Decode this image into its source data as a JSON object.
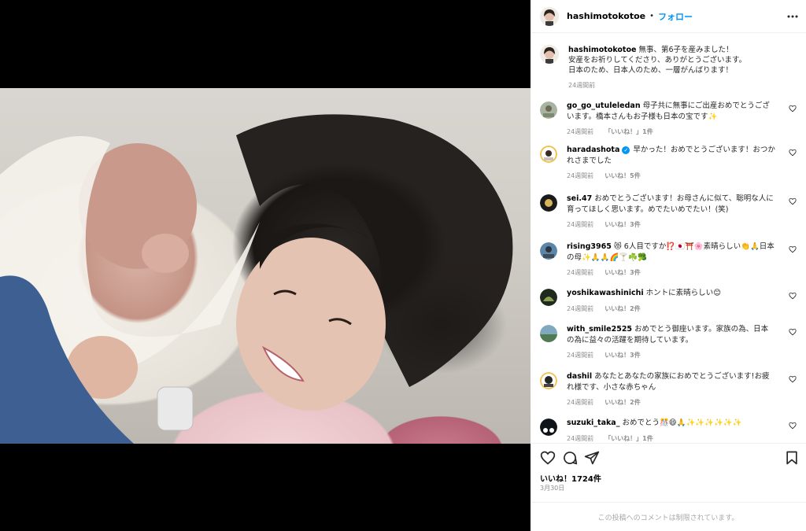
{
  "header": {
    "username": "hashimotokotoe",
    "separator": "•",
    "follow_label": "フォロー"
  },
  "caption": {
    "username": "hashimotokotoe",
    "text": "無事、第6子を産みました！\n安産をお祈りしてくださり、ありがとうございます。\n日本のため、日本人のため、一層がんばります！",
    "time": "24週間前"
  },
  "comments": [
    {
      "username": "go_go_utuleledan",
      "text": "母子共に無事にご出産おめでとうございます。橋本さんもお子様も日本の宝です✨",
      "time": "24週間前",
      "likes": "「いいね！」1件",
      "reply": ""
    },
    {
      "username": "haradashota",
      "verified": true,
      "text": "早かった！おめでとうございます！おつかれさまでした",
      "time": "24週間前",
      "likes": "いいね！5件",
      "reply": ""
    },
    {
      "username": "sei.47",
      "text": "おめでとうございます！お母さんに似て、聡明な人に育ってほしく思います。めでたいめでたい！(笑)",
      "time": "24週間前",
      "likes": "いいね！3件",
      "reply": ""
    },
    {
      "username": "rising3965",
      "text": "😻 6人目ですか⁉️🇯🇵⛩️🌸素晴らしい👏🙏日本の母✨🙏🙏🌈🍸☘️🥦",
      "time": "24週間前",
      "likes": "いいね！3件",
      "reply": ""
    },
    {
      "username": "yoshikawashinichi",
      "text": "ホントに素晴らしい😊",
      "time": "24週間前",
      "likes": "いいね！2件",
      "reply": ""
    },
    {
      "username": "with_smile2525",
      "text": "おめでとう御座います。家族の為、日本の為に益々の活躍を期待しています。",
      "time": "24週間前",
      "likes": "いいね！3件",
      "reply": ""
    },
    {
      "username": "dashil",
      "text": "あなたとあなたの家族におめでとうございます!お疲れ様です、小さな赤ちゃん",
      "time": "24週間前",
      "likes": "いいね！2件",
      "reply": ""
    },
    {
      "username": "suzuki_taka_",
      "text": "おめでとう🎊😄🙏✨✨✨✨✨✨",
      "time": "24週間前",
      "likes": "「いいね！」1件",
      "reply": ""
    }
  ],
  "likes_text": "いいね！1724件",
  "date_text": "3月30日",
  "footer_text": "この投稿へのコメントは制限されています。",
  "colors": {
    "accent": "#0095f6",
    "verified": "#0095f6",
    "secondary_text": "#8e8e8e"
  }
}
